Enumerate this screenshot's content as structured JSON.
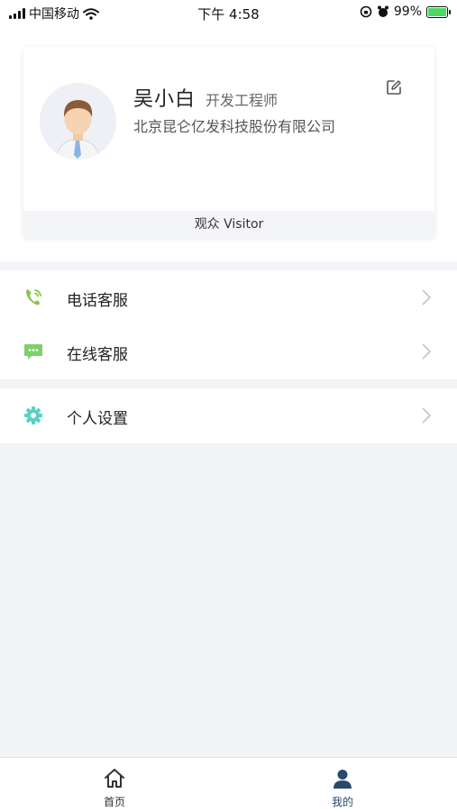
{
  "status_bar": {
    "carrier": "中国移动",
    "time": "下午 4:58",
    "battery": "99%"
  },
  "profile": {
    "name": "吴小白",
    "title": "开发工程师",
    "company": "北京昆仑亿发科技股份有限公司",
    "role": "观众 Visitor"
  },
  "menu": {
    "items": [
      {
        "label": "电话客服",
        "icon": "phone-icon",
        "color": "#8bc34a"
      },
      {
        "label": "在线客服",
        "icon": "chat-icon",
        "color": "#7ed06a"
      },
      {
        "label": "个人设置",
        "icon": "gear-icon",
        "color": "#5ccfc4"
      }
    ]
  },
  "tabs": [
    {
      "label": "首页",
      "icon": "home-icon",
      "active": false
    },
    {
      "label": "我的",
      "icon": "user-icon",
      "active": true
    }
  ],
  "colors": {
    "accent": "#2a4a6b",
    "background": "#f3f4f7",
    "inactive": "#333333"
  }
}
